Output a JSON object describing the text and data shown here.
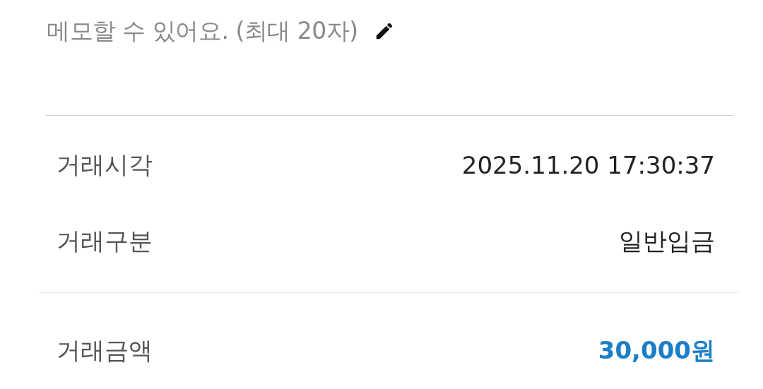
{
  "memo": {
    "text": "메모할 수 있어요. (최대 20자)"
  },
  "details": [
    {
      "label": "거래시각",
      "value": "2025.11.20 17:30:37"
    },
    {
      "label": "거래구분",
      "value": "일반입금"
    }
  ],
  "amount": {
    "label": "거래금액",
    "value": "30,000원"
  }
}
